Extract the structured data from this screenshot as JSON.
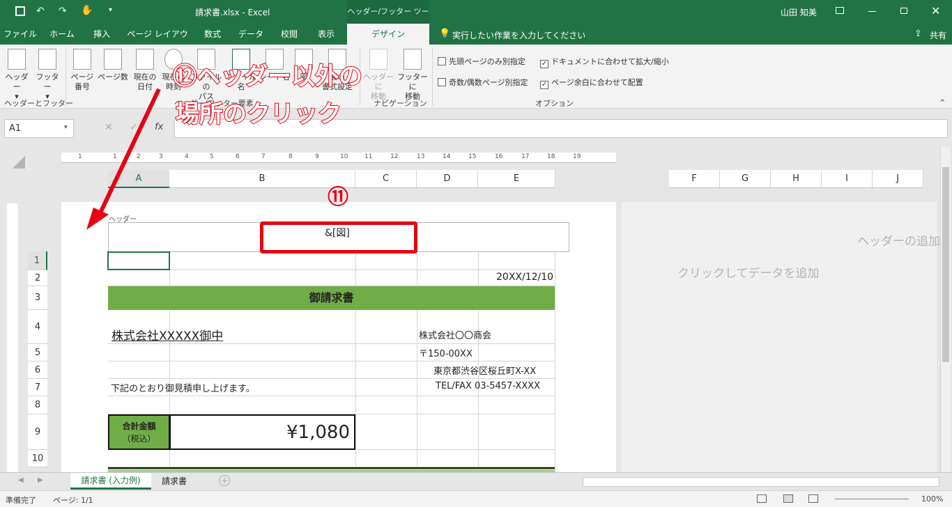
{
  "app": {
    "doc_title": "請求書.xlsx  -  Excel",
    "context_tab": "ヘッダー/フッター ツール",
    "user": "山田 知美"
  },
  "tabs": [
    "ファイル",
    "ホーム",
    "挿入",
    "ページ レイアウト",
    "数式",
    "データ",
    "校閲",
    "表示",
    "デザイン"
  ],
  "tell_me": "実行したい作業を入力してください",
  "share": "共有",
  "ribbon": {
    "header_btn": "ヘッダー",
    "footer_btn": "フッター",
    "page_num": "ページ\n番号",
    "page_count": "ページ数",
    "cur_date": "現在の\n日付",
    "cur_time": "現在の\n時刻",
    "file_path": "ファイルの\nパス",
    "file_name": "ファイル名",
    "sheet_name": "シート名",
    "picture": "図",
    "format_pic": "図の\n書式設定",
    "goto_header": "ヘッダーに\n移動",
    "goto_footer": "フッターに\n移動",
    "grp_hf": "ヘッダーとフッター",
    "grp_elements": "ヘッダー/フッター要素",
    "grp_nav": "ナビゲーション",
    "grp_opt": "オプション",
    "opt1": "先頭ページのみ別指定",
    "opt2": "奇数/偶数ページ別指定",
    "opt3": "ドキュメントに合わせて拡大/縮小",
    "opt4": "ページ余白に合わせて配置"
  },
  "namebox": "A1",
  "ruler": [
    "1",
    "1",
    "2",
    "3",
    "4",
    "5",
    "6",
    "7",
    "8",
    "9",
    "10",
    "11",
    "12",
    "13",
    "14",
    "15",
    "16",
    "17",
    "18",
    "19"
  ],
  "columns": [
    "A",
    "B",
    "C",
    "D",
    "E"
  ],
  "columns_right": [
    "F",
    "G",
    "H",
    "I",
    "J"
  ],
  "rows": [
    "1",
    "2",
    "3",
    "4",
    "5",
    "6",
    "7",
    "8",
    "9",
    "10"
  ],
  "sheet": {
    "header_label": "ヘッダー",
    "header_code": "&[図]",
    "date": "20XX/12/10",
    "title": "御請求書",
    "to": "株式会社XXXXX御中",
    "from_company": "株式会社〇〇商会",
    "postal": "〒150-00XX",
    "address": "東京都渋谷区桜丘町X-XX",
    "tel": "TEL/FAX 03-5457-XXXX",
    "note": "下記のとおり御見積申し上げます。",
    "total_label": "合計金額",
    "total_sub": "（税込）",
    "total_value": "¥1,080",
    "add_header": "ヘッダーの追加",
    "add_data": "クリックしてデータを追加"
  },
  "annotations": {
    "num11": "⑪",
    "text12_line1": "⑫ヘッダー以外の",
    "text12_line2": "場所のクリック"
  },
  "sheets": [
    "請求書 (入力例)",
    "請求書"
  ],
  "status": {
    "ready": "準備完了",
    "page": "ページ: 1/1",
    "zoom": "100%"
  },
  "colors": {
    "excel_green": "#217346",
    "title_fill": "#70ad47",
    "total_fill": "#70ad47",
    "annotation": "#e60012"
  }
}
